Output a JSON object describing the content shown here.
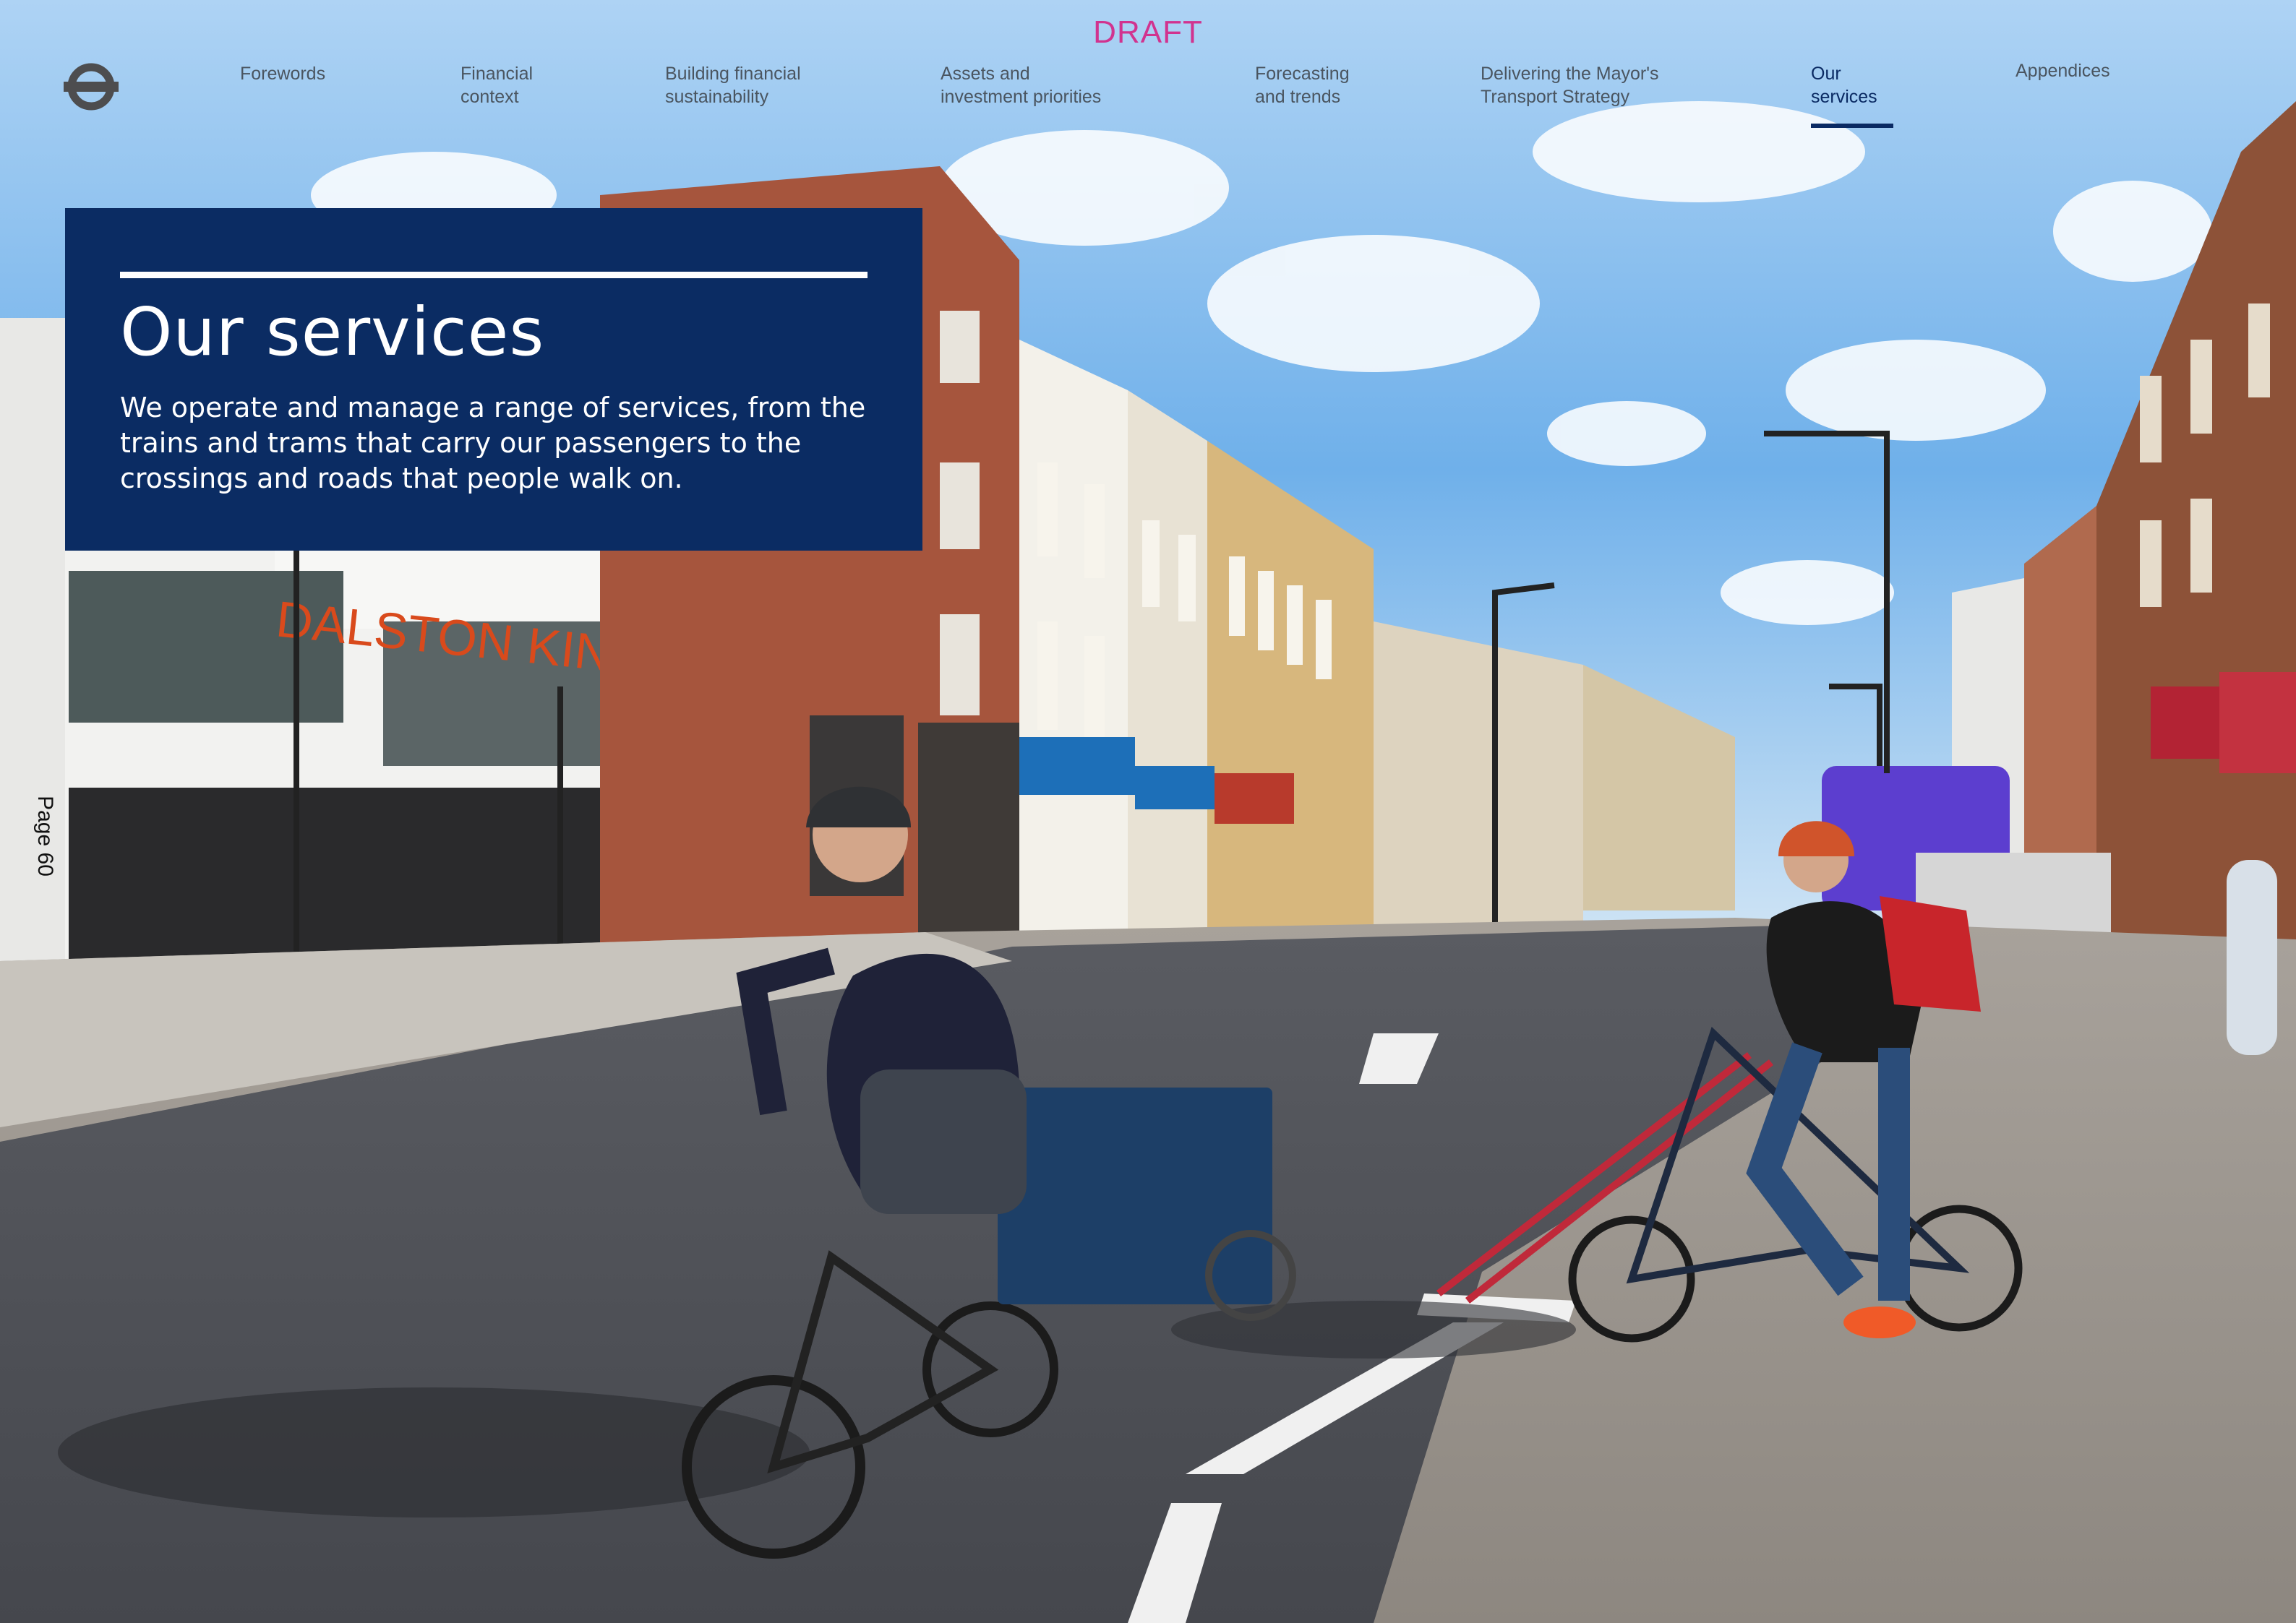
{
  "header": {
    "draft_label": "DRAFT",
    "logo_icon": "roundel-icon",
    "nav": [
      {
        "label": "Forewords",
        "active": false
      },
      {
        "label": "Financial\ncontext",
        "active": false
      },
      {
        "label": "Building financial\nsustainability",
        "active": false
      },
      {
        "label": "Assets and\ninvestment priorities",
        "active": false
      },
      {
        "label": "Forecasting\nand trends",
        "active": false
      },
      {
        "label": "Delivering the Mayor's\nTransport Strategy",
        "active": false
      },
      {
        "label": "Our\nservices",
        "active": true
      },
      {
        "label": "Appendices",
        "active": false
      }
    ]
  },
  "hero": {
    "title": "Our services",
    "description": "We operate and manage a range of services, from the trains and trams that carry our passengers to the crossings and roads that people walk on."
  },
  "page": {
    "number_label": "Page 60"
  },
  "colors": {
    "hero_background": "#0b2c63",
    "draft_text": "#d1338f",
    "nav_active": "#0a2a63",
    "nav_text": "#4a5560"
  }
}
